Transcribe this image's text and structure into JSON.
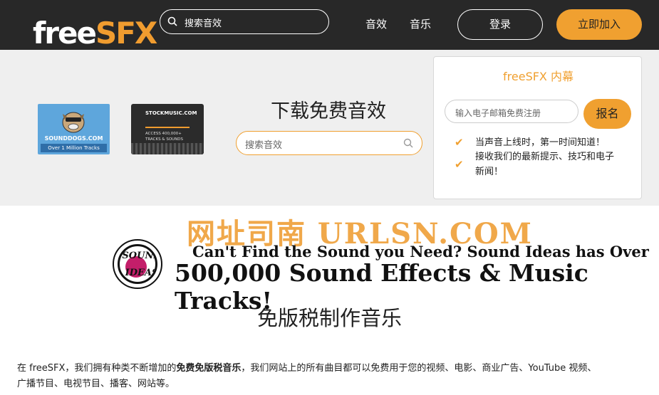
{
  "header": {
    "logo_free": "free",
    "logo_sfx": "SFX",
    "search_placeholder": "搜索音效",
    "nav": [
      "音效",
      "音乐"
    ],
    "login": "登录",
    "join": "立即加入"
  },
  "hero": {
    "ad1": {
      "title": "SOUNDDOGS.COM",
      "tagline": "Over 1 Million Tracks"
    },
    "ad2": {
      "title": "STOCKMUSIC.COM",
      "line1": "ACCESS 400,000+",
      "line2": "TRACKS & SOUNDS"
    },
    "title": "下载免费音效",
    "search_placeholder": "搜索音效"
  },
  "signup": {
    "title": "freeSFX 内幕",
    "email_placeholder": "输入电子邮箱免费注册",
    "button": "报名",
    "items": [
      "当声音上线时，第一时间知道！",
      "接收我们的最新提示、技巧和电子",
      "新闻！"
    ]
  },
  "banner": {
    "watermark": "网址司南 URLSN.COM",
    "logo_top": "SOUND",
    "logo_bottom": "IDEAS",
    "line1": "Can't Find the Sound you Need?  Sound Ideas has Over",
    "line2": "500,000 Sound Effects & Music Tracks!"
  },
  "main": {
    "subtitle": "免版税制作音乐",
    "para_a": "在 freeSFX，我们拥有种类不断增加的",
    "para_bold": "免费免版税音乐",
    "para_b": "，我们网站上的所有曲目都可以免费用于您的视频、电影、商业广告、YouTube 视频、",
    "para_c": "广播节目、电视节目、播客、网站等。"
  },
  "colors": {
    "accent": "#f0a030",
    "header_bg": "#282828",
    "hero_bg": "#efefef"
  }
}
